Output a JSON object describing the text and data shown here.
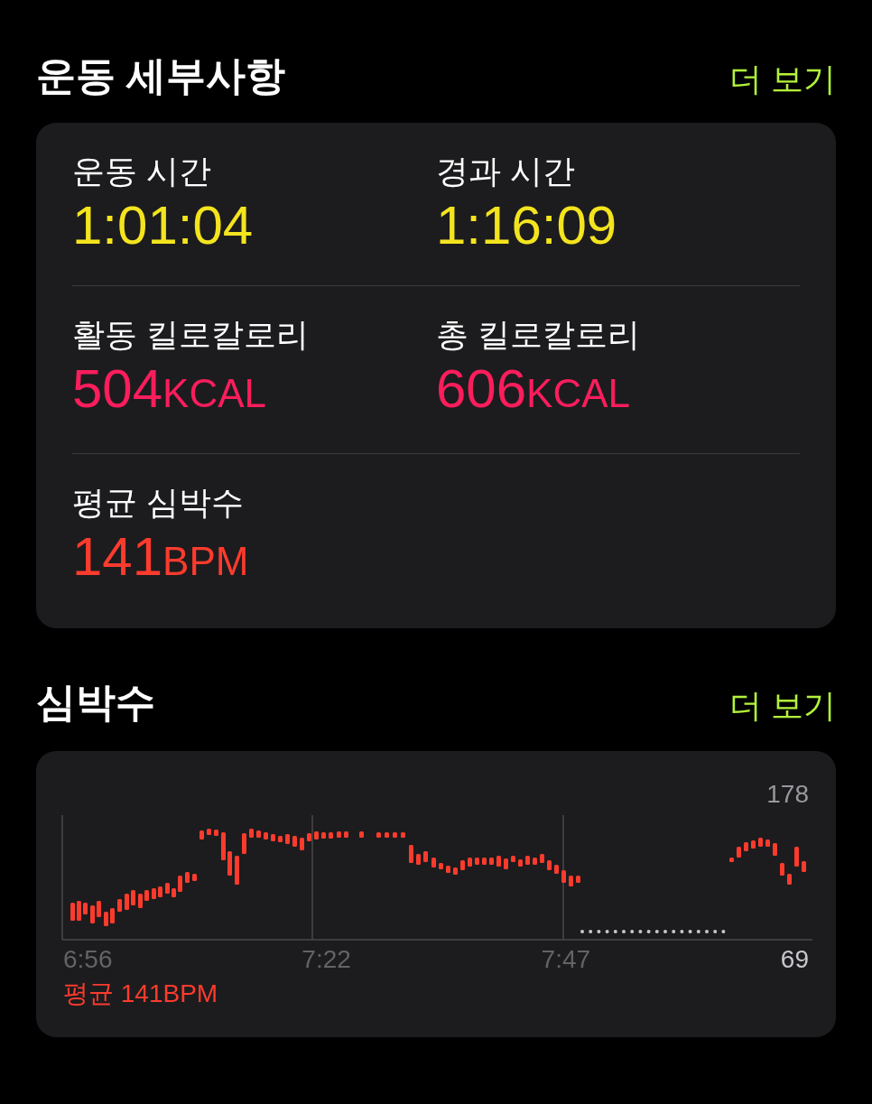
{
  "workout_details": {
    "title": "운동 세부사항",
    "more_link": "더 보기",
    "metrics": [
      {
        "label": "운동 시간",
        "value": "1:01:04",
        "color": "#f4e41e"
      },
      {
        "label": "경과 시간",
        "value": "1:16:09",
        "color": "#f4e41e"
      },
      {
        "label": "활동 킬로칼로리",
        "value": "504",
        "unit": "KCAL",
        "color": "#fb1d5c"
      },
      {
        "label": "총 킬로칼로리",
        "value": "606",
        "unit": "KCAL",
        "color": "#fb1d5c"
      },
      {
        "label": "평균 심박수",
        "value": "141",
        "unit": "BPM",
        "color": "#fd3b2d"
      }
    ]
  },
  "heart_rate": {
    "title": "심박수",
    "more_link": "더 보기",
    "max_label": "178",
    "min_label": "69",
    "time_labels": [
      "6:56",
      "7:22",
      "7:47"
    ],
    "average": "평균 141BPM"
  }
}
